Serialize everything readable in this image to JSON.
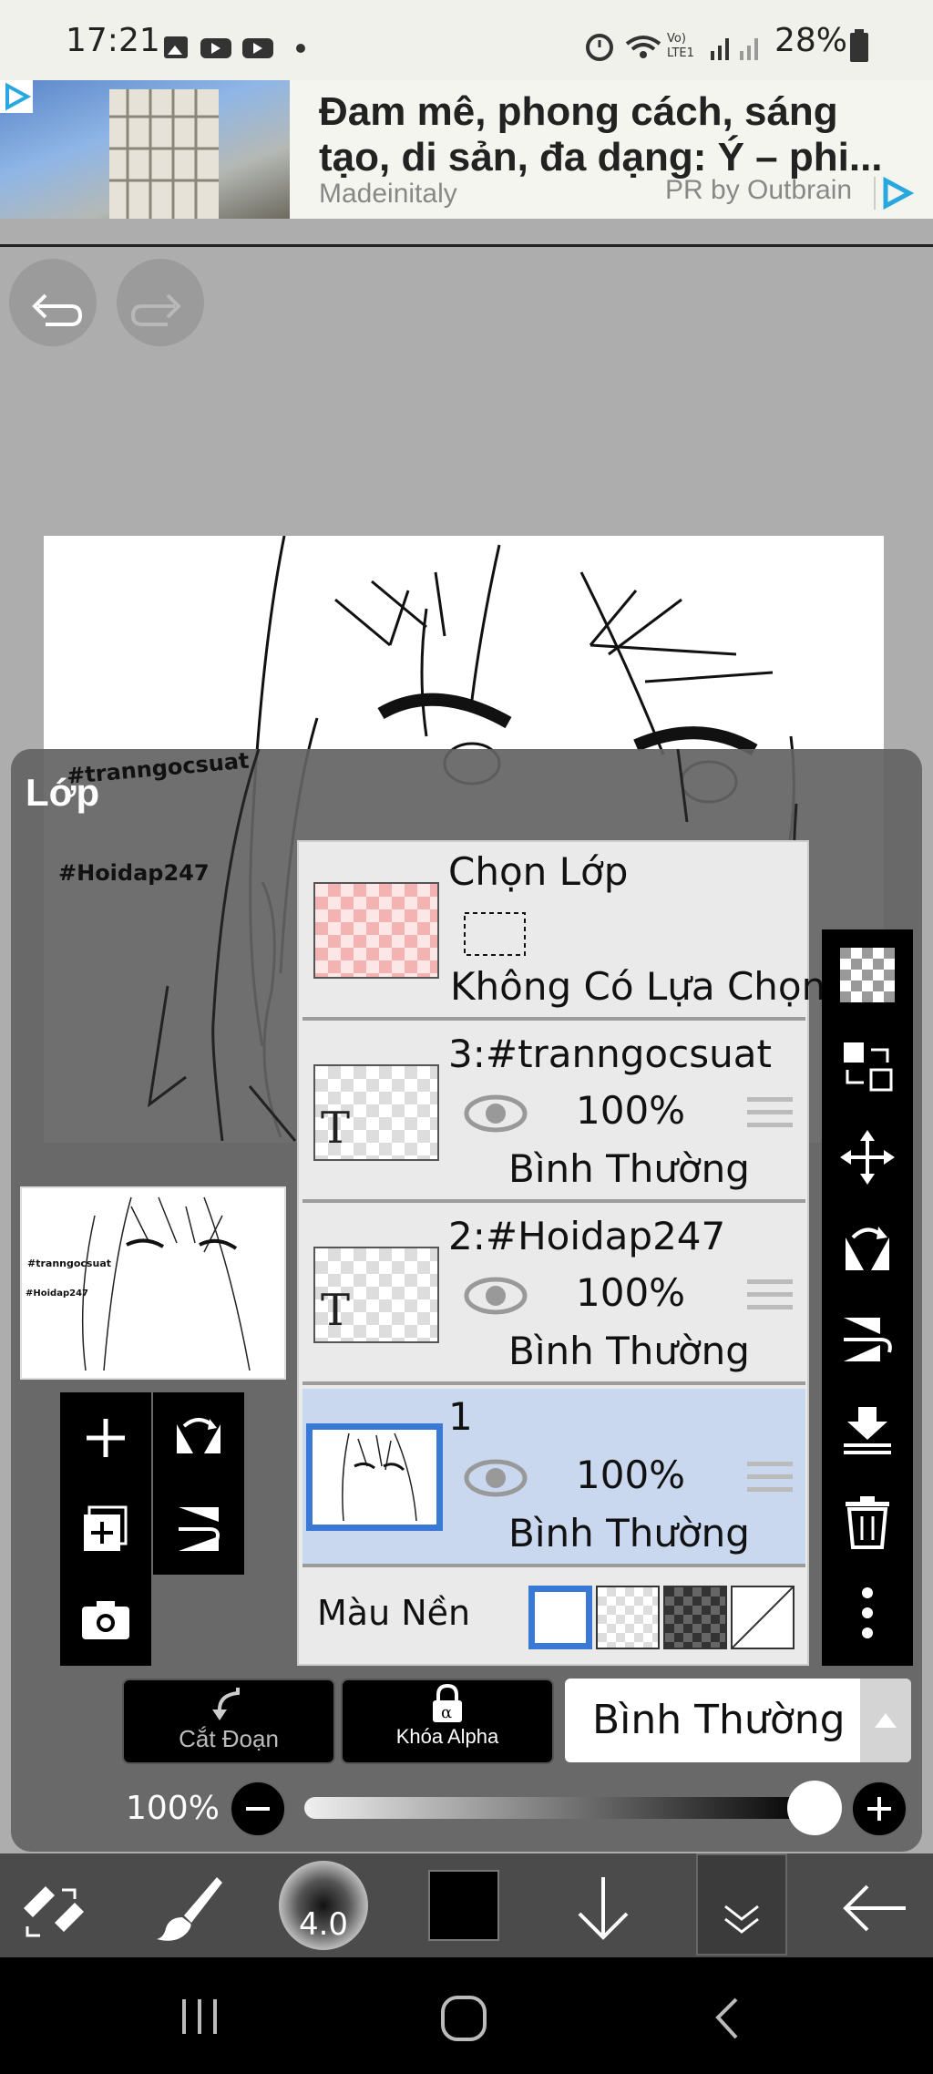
{
  "status_bar": {
    "time": "17:21",
    "battery": "28%",
    "network": "Vo) LTE1"
  },
  "ad": {
    "title": "Đam mê, phong cách, sáng tạo, di sản, đa dạng: Ý – phi...",
    "source": "Madeinitaly",
    "provider": "PR by Outbrain"
  },
  "canvas": {
    "watermark_1": "#tranngocsuat",
    "watermark_2": "#Hoidap247"
  },
  "layer_panel": {
    "title": "Lớp",
    "selection_layer": {
      "name": "Chọn Lớp",
      "status": "Không Có Lựa Chọn"
    },
    "layers": [
      {
        "name": "3:#tranngocsuat",
        "opacity": "100%",
        "blend": "Bình Thường",
        "thumb_letter": "T"
      },
      {
        "name": "2:#Hoidap247",
        "opacity": "100%",
        "blend": "Bình Thường",
        "thumb_letter": "T"
      },
      {
        "name": "1",
        "opacity": "100%",
        "blend": "Bình Thường",
        "selected": true
      }
    ],
    "background_label": "Màu Nền",
    "preview_text_1": "#tranngocsuat",
    "preview_text_2": "#Hoidap247"
  },
  "controls": {
    "clipping_label": "Cắt Đoạn",
    "alpha_lock_label": "Khóa Alpha",
    "blend_mode": "Bình Thường",
    "opacity": "100%"
  },
  "bottom_toolbar": {
    "brush_size": "4.0",
    "color": "#000000"
  },
  "colors": {
    "accent": "#3a78d6",
    "selected_row": "#c9d7ef"
  }
}
